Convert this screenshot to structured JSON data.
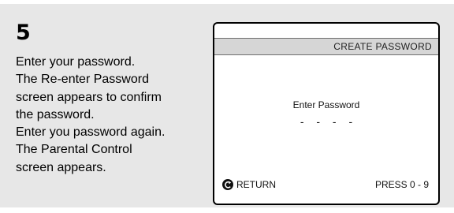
{
  "step": {
    "number": "5",
    "instructions": [
      "Enter your password.",
      "The Re-enter Password",
      "screen appears to confirm",
      "the password.",
      "Enter you password again.",
      "The Parental Control",
      "screen appears."
    ]
  },
  "screen": {
    "title": "CREATE PASSWORD",
    "prompt": "Enter Password",
    "password_mask": "- - - -",
    "return_label": "RETURN",
    "return_icon": "return-arrow-icon",
    "press_hint": "PRESS 0 - 9"
  }
}
